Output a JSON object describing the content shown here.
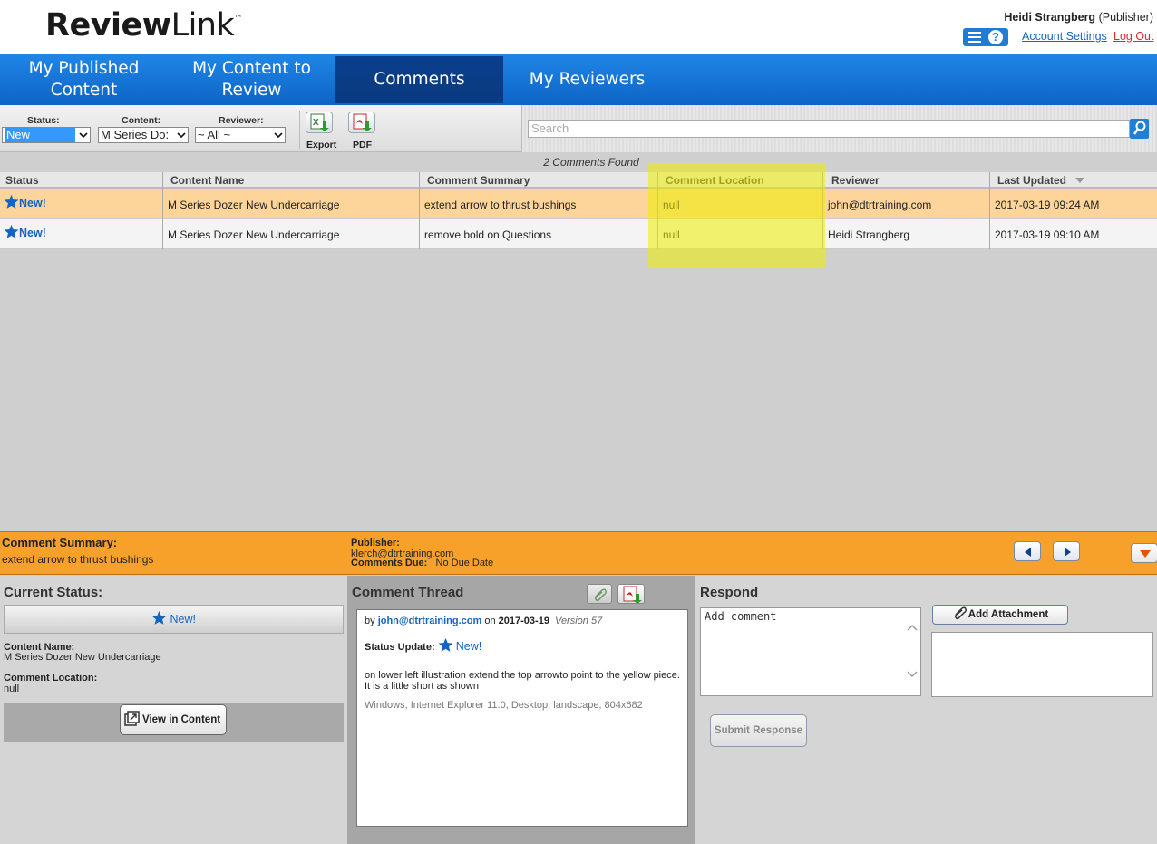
{
  "header": {
    "logo_bold": "Review",
    "logo_light": "Link",
    "logo_tm": "™",
    "user_name": "Heidi Strangberg",
    "user_role": "(Publisher)",
    "account_settings": "Account Settings",
    "logout": "Log Out",
    "help_glyph": "?"
  },
  "nav": {
    "tabs": [
      {
        "label": "My Published Content"
      },
      {
        "label": "My Content to Review"
      },
      {
        "label": "Comments",
        "active": true
      },
      {
        "label": "My Reviewers"
      }
    ]
  },
  "toolbar": {
    "status_label": "Status:",
    "status_value": "New",
    "content_label": "Content:",
    "content_value": "M Series Do:",
    "reviewer_label": "Reviewer:",
    "reviewer_value": "~ All ~",
    "export_label": "Export",
    "pdf_label": "PDF",
    "search_placeholder": "Search"
  },
  "table": {
    "count": "2 Comments Found",
    "columns": [
      "Status",
      "Content Name",
      "Comment Summary",
      "Comment Location",
      "Reviewer",
      "Last Updated"
    ],
    "rows": [
      {
        "status": "New!",
        "content_name": "M Series Dozer New Undercarriage",
        "summary": "extend arrow to thrust bushings",
        "location": "null",
        "reviewer": "john@dtrtraining.com",
        "updated": "2017-03-19 09:24 AM"
      },
      {
        "status": "New!",
        "content_name": "M Series Dozer New Undercarriage",
        "summary": "remove bold on Questions",
        "location": "null",
        "reviewer": "Heidi Strangberg",
        "updated": "2017-03-19 09:10 AM"
      }
    ]
  },
  "summary_bar": {
    "label": "Comment Summary:",
    "text": "extend arrow to thrust bushings",
    "publisher_label": "Publisher:",
    "publisher_email": "klerch@dtrtraining.com",
    "due_label": "Comments Due:",
    "due_value": "No Due Date"
  },
  "status_panel": {
    "title": "Current Status:",
    "status": "New!",
    "content_name_label": "Content Name:",
    "content_name": "M Series Dozer New Undercarriage",
    "location_label": "Comment Location:",
    "location": "null",
    "view_button": "View in Content"
  },
  "thread": {
    "title": "Comment Thread",
    "by": "by",
    "author": "john@dtrtraining.com",
    "on": "on",
    "date": "2017-03-19",
    "version": "Version 57",
    "status_update_label": "Status Update:",
    "status": "New!",
    "body": "on lower left illustration extend the top arrowto point to the yellow piece. It is a little short as shown",
    "meta": "Windows, Internet Explorer 11.0, Desktop, landscape, 804x682"
  },
  "respond": {
    "title": "Respond",
    "placeholder": "Add comment",
    "attach_button": "Add Attachment",
    "submit_button": "Submit Response"
  },
  "colors": {
    "nav_blue": "#0d64c6",
    "active_tab": "#0a3a80",
    "selected_row": "#fdd59a",
    "summary_orange": "#f7a12a",
    "highlight": "#eeee00"
  }
}
